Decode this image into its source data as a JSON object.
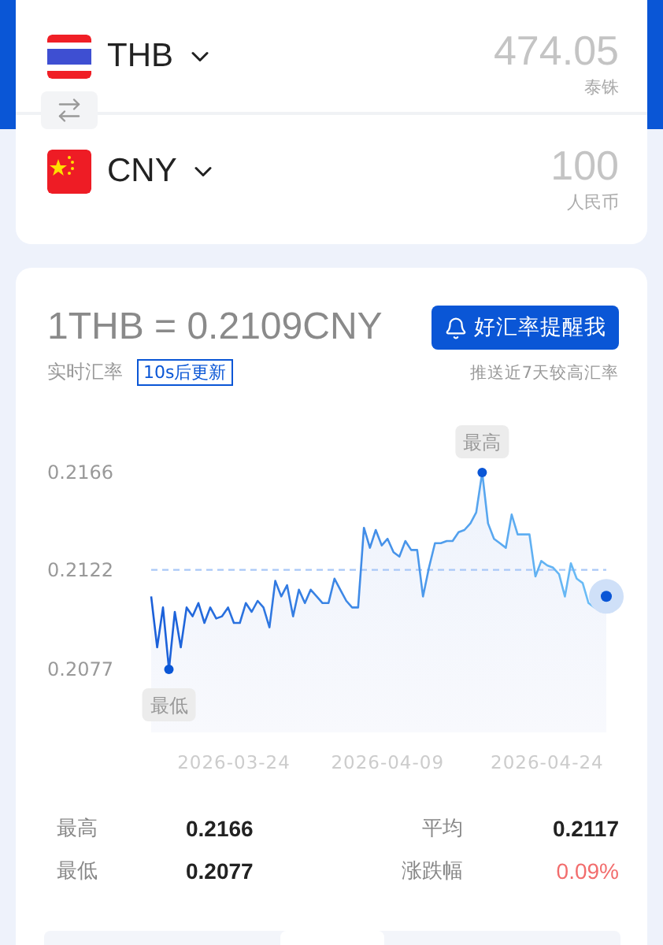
{
  "converter": {
    "rows": [
      {
        "code": "THB",
        "kind": "th",
        "amount": "474.05",
        "name": "泰铢"
      },
      {
        "code": "CNY",
        "kind": "cn",
        "amount": "100",
        "name": "人民币"
      }
    ]
  },
  "rate": {
    "title": "1THB = 0.2109CNY",
    "label": "实时汇率",
    "countdown": "10s后更新",
    "alert_button": "好汇率提醒我",
    "note": "推送近7天较高汇率"
  },
  "chart_data": {
    "type": "area",
    "ylim": [
      0.2077,
      0.2166
    ],
    "yticks": [
      0.2077,
      0.2122,
      0.2166
    ],
    "categories": [
      null,
      null,
      null,
      null,
      null,
      null,
      null,
      null,
      null,
      null,
      null,
      null,
      null,
      null,
      "2026-03-24",
      null,
      null,
      null,
      null,
      null,
      null,
      null,
      null,
      null,
      null,
      null,
      null,
      null,
      null,
      null,
      null,
      null,
      null,
      null,
      null,
      null,
      null,
      null,
      null,
      null,
      "2026-04-09",
      null,
      null,
      null,
      null,
      null,
      null,
      null,
      null,
      null,
      null,
      null,
      null,
      null,
      null,
      null,
      null,
      null,
      null,
      null,
      null,
      null,
      null,
      null,
      null,
      null,
      null,
      "2026-04-24",
      null,
      null,
      null,
      null,
      null,
      null,
      null,
      null,
      null,
      null
    ],
    "series": [
      {
        "color": "#1a5fd9",
        "values": [
          0.211,
          0.2087,
          0.2105,
          0.2077,
          0.2103,
          0.2087,
          0.2105,
          0.2101,
          0.2107,
          0.2098,
          0.2105,
          0.21,
          0.2101,
          0.2105,
          0.2098,
          0.2098,
          0.2107,
          0.2103,
          0.2108,
          0.2105,
          0.2096,
          0.2117,
          0.211,
          0.2115,
          0.2101,
          0.2113,
          0.2107,
          0.2113,
          0.211,
          0.2107,
          0.2107,
          0.2118,
          0.2113,
          0.2108,
          0.2105,
          0.2105,
          0.2141,
          0.2132,
          0.214,
          0.2133,
          0.2136,
          0.213,
          0.2128,
          0.2135,
          0.2131,
          0.2131,
          0.211,
          0.2123,
          0.2134,
          0.2134,
          0.2135,
          0.2135,
          0.2139,
          0.214,
          0.2143,
          0.2148,
          0.2166,
          0.2143,
          0.2136,
          0.2134,
          0.2132,
          0.2147,
          0.2138,
          0.2138,
          0.2138,
          0.2119,
          0.2126,
          0.2124,
          0.2123,
          0.212,
          0.211,
          0.2125,
          0.2118,
          0.2116,
          0.2107,
          0.2105,
          0.2108,
          0.211
        ]
      }
    ],
    "ref_lines": [
      {
        "axis": "y",
        "value": 0.2122
      }
    ],
    "annotations": [
      {
        "text": "最高",
        "y": 0.2166
      },
      {
        "text": "最低",
        "y": 0.2077
      }
    ]
  },
  "stats": [
    {
      "label": "最高",
      "value": "0.2166",
      "kind": "plain"
    },
    {
      "label": "平均",
      "value": "0.2117",
      "kind": "plain"
    },
    {
      "label": "最低",
      "value": "0.2077",
      "kind": "plain"
    },
    {
      "label": "涨跌幅",
      "value": "0.09%",
      "kind": "change"
    }
  ]
}
